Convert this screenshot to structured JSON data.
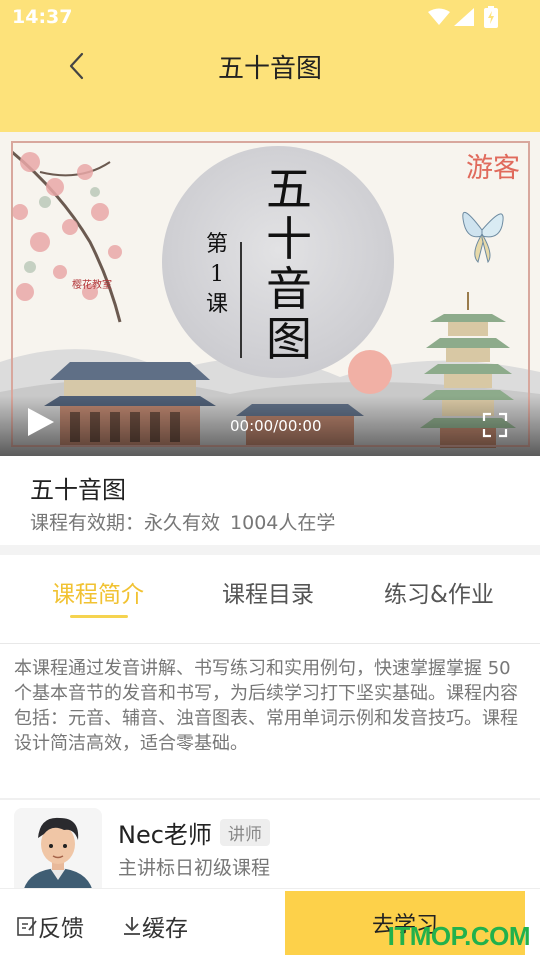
{
  "status_bar": {
    "time": "14:37"
  },
  "header": {
    "title": "五十音图"
  },
  "video": {
    "guest_badge": "游客",
    "title_big": "五十音图",
    "lesson_label": "第1课",
    "seal_text": "樱花教室",
    "time_readout": "00:00/00:00"
  },
  "course": {
    "name": "五十音图",
    "validity": "课程有效期：永久有效",
    "learners": "1004人在学"
  },
  "tabs": [
    {
      "label": "课程简介",
      "active": true
    },
    {
      "label": "课程目录",
      "active": false
    },
    {
      "label": "练习&作业",
      "active": false
    }
  ],
  "intro": "本课程通过发音讲解、书写练习和实用例句，快速掌握掌握 50 个基本音节的发音和书写，为后续学习打下坚实基础。课程内容包括：元音、辅音、浊音图表、常用单词示例和发音技巧。课程设计简洁高效，适合零基础。",
  "teacher": {
    "name": "Nec老师",
    "role": "讲师",
    "desc": "主讲标日初级课程"
  },
  "bottom_bar": {
    "feedback": "反馈",
    "cache": "缓存",
    "study": "去学习"
  },
  "watermark": "ITMOP.COM",
  "colors": {
    "header_bg": "#fde27a",
    "accent": "#f1c232",
    "study_button": "#fdd14a"
  }
}
